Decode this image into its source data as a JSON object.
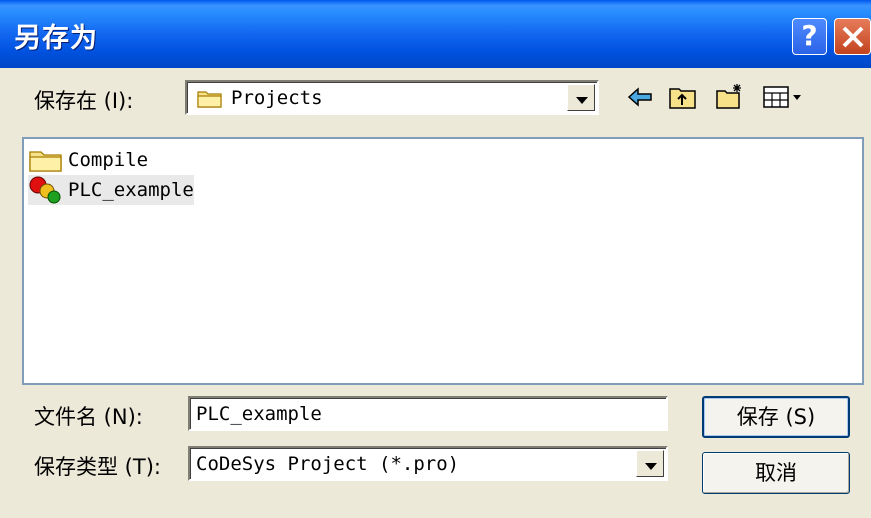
{
  "window": {
    "title": "另存为"
  },
  "titlebar": {
    "help_label": "?"
  },
  "location": {
    "label": "保存在 (I):",
    "value": "Projects"
  },
  "files": [
    {
      "name": "Compile",
      "icon": "folder-icon",
      "selected": false
    },
    {
      "name": "PLC_example",
      "icon": "codesys-project-icon",
      "selected": true
    }
  ],
  "filename": {
    "label": "文件名 (N):",
    "value": "PLC_example"
  },
  "filetype": {
    "label": "保存类型 (T):",
    "value": "CoDeSys Project (*.pro)"
  },
  "buttons": {
    "save": "保存 (S)",
    "cancel": "取消"
  },
  "colors": {
    "titlebar": "#0a5fe6",
    "dialog_bg": "#ece9d8",
    "close": "#d9542c"
  }
}
